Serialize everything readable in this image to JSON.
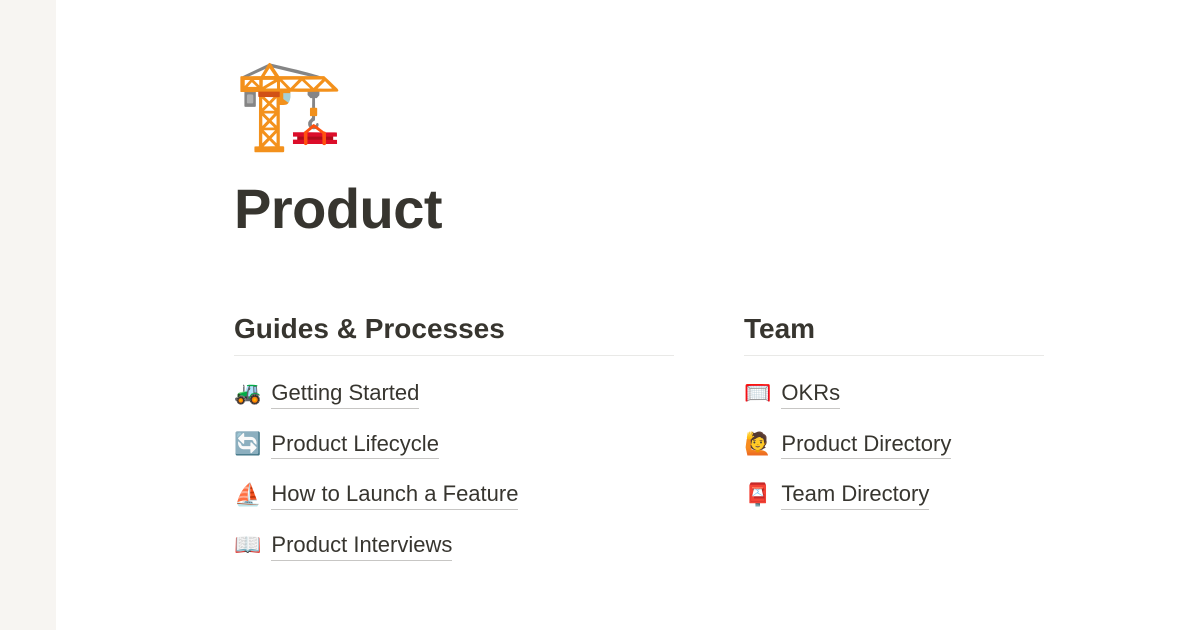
{
  "page": {
    "icon": "🏗️",
    "title": "Product"
  },
  "sections": {
    "guides": {
      "title": "Guides & Processes",
      "items": [
        {
          "icon": "🚜",
          "label": "Getting Started"
        },
        {
          "icon": "🔄",
          "label": "Product Lifecycle"
        },
        {
          "icon": "⛵",
          "label": "How to Launch a Feature"
        },
        {
          "icon": "📖",
          "label": "Product Interviews"
        }
      ]
    },
    "team": {
      "title": "Team",
      "items": [
        {
          "icon": "🥅",
          "label": "OKRs"
        },
        {
          "icon": "🙋",
          "label": "Product Directory"
        },
        {
          "icon": "📮",
          "label": "Team Directory"
        }
      ]
    }
  }
}
